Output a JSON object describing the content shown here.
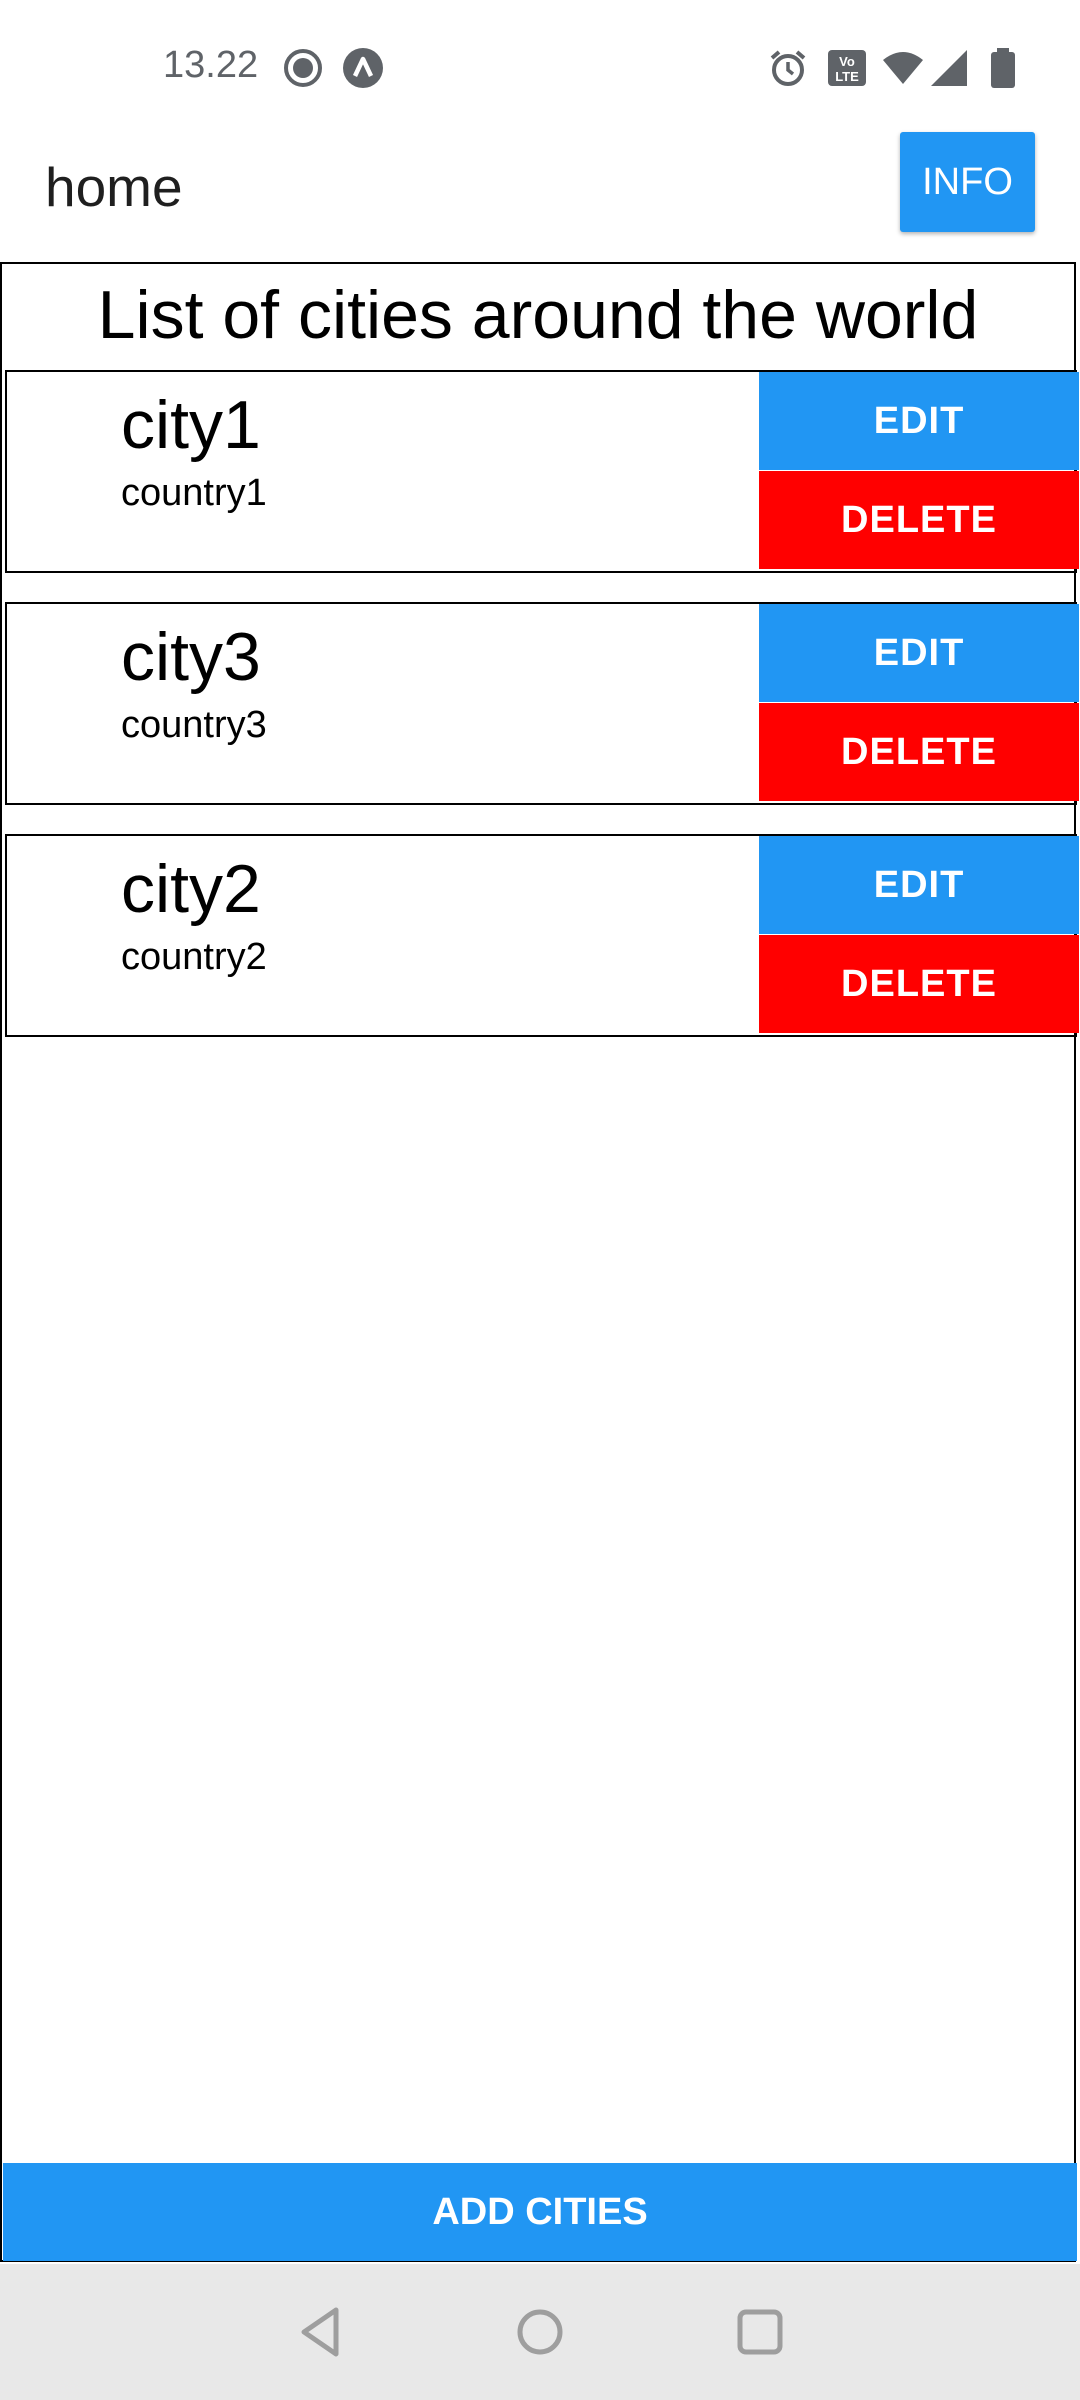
{
  "status_bar": {
    "time": "13.22",
    "left_icons": [
      "record-icon",
      "app-a-icon"
    ],
    "right_icons": [
      "alarm-icon",
      "volte-icon",
      "wifi-icon",
      "signal-icon",
      "battery-icon"
    ],
    "volte_label": "Vo LTE"
  },
  "header": {
    "title": "home",
    "info_button": "INFO"
  },
  "list": {
    "heading": "List of cities around the world",
    "items": [
      {
        "city": "city1",
        "country": "country1",
        "edit": "EDIT",
        "delete": "DELETE"
      },
      {
        "city": "city3",
        "country": "country3",
        "edit": "EDIT",
        "delete": "DELETE"
      },
      {
        "city": "city2",
        "country": "country2",
        "edit": "EDIT",
        "delete": "DELETE"
      }
    ]
  },
  "footer": {
    "add_button": "ADD CITIES"
  },
  "nav": {
    "icons": [
      "back-icon",
      "home-icon",
      "recents-icon"
    ]
  },
  "colors": {
    "primary": "#2196f3",
    "danger": "#ff0000",
    "nav_bg": "#e8e8e8"
  }
}
